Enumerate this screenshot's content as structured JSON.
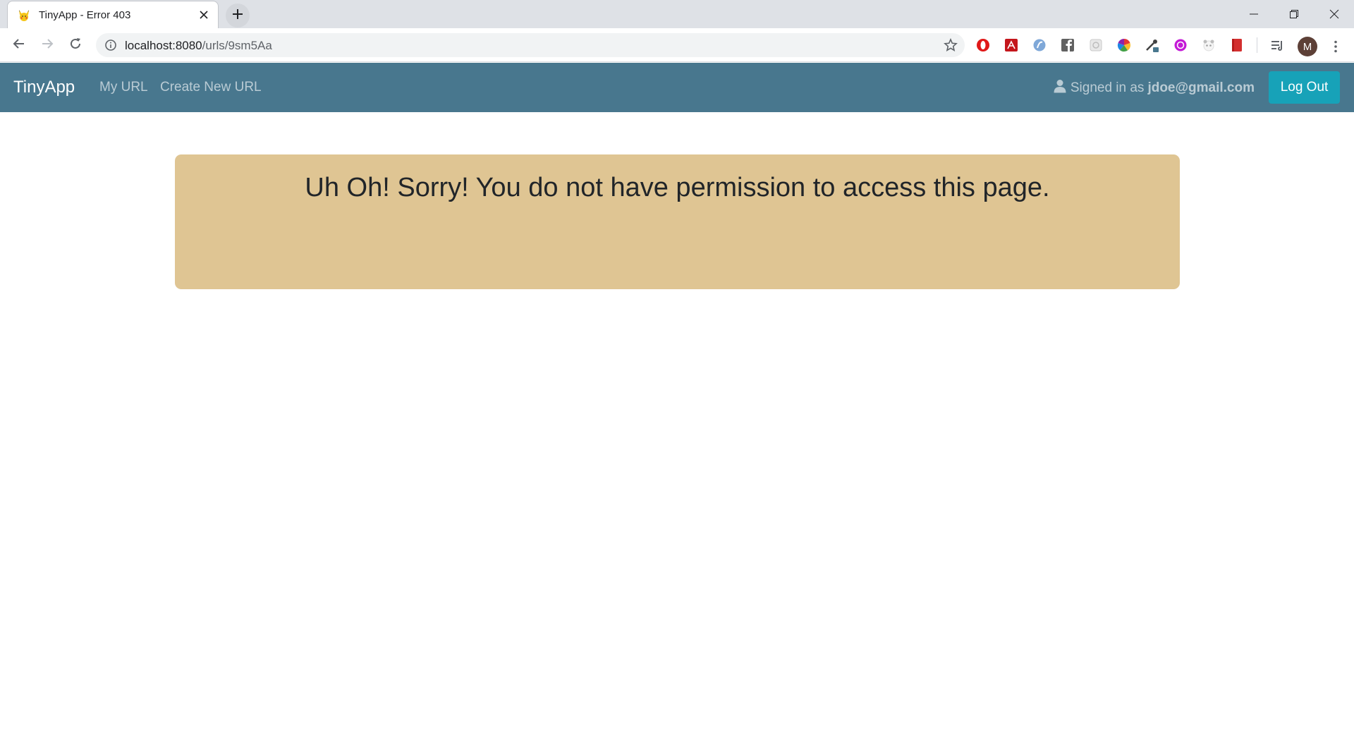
{
  "browser": {
    "tab_title": "TinyApp - Error 403",
    "url_host": "localhost:8080",
    "url_path": "/urls/9sm5Aa",
    "profile_initial": "M",
    "icons": {
      "favicon": "pikachu-icon",
      "close": "close-icon",
      "new_tab": "plus-icon",
      "back": "back-arrow-icon",
      "forward": "forward-arrow-icon",
      "reload": "reload-icon",
      "info": "info-icon",
      "bookmark": "star-icon",
      "menu": "more-vertical-icon",
      "extensions": [
        "opera-icon",
        "acrobat-icon",
        "translate-icon",
        "facebook-icon",
        "screenshot-icon",
        "color-wheel-icon",
        "eyedropper-icon",
        "vpn-icon",
        "panda-icon",
        "book-icon",
        "reading-list-icon"
      ]
    }
  },
  "navbar": {
    "brand": "TinyApp",
    "links": [
      "My URL",
      "Create New URL"
    ],
    "signed_in_prefix": "Signed in as",
    "email": "jdoe@gmail.com",
    "logout_label": "Log Out",
    "color": "#48778e",
    "button_color": "#17a2b8"
  },
  "alert": {
    "message": "Uh Oh! Sorry! You do not have permission to access this page.",
    "color": "#dfc593"
  }
}
